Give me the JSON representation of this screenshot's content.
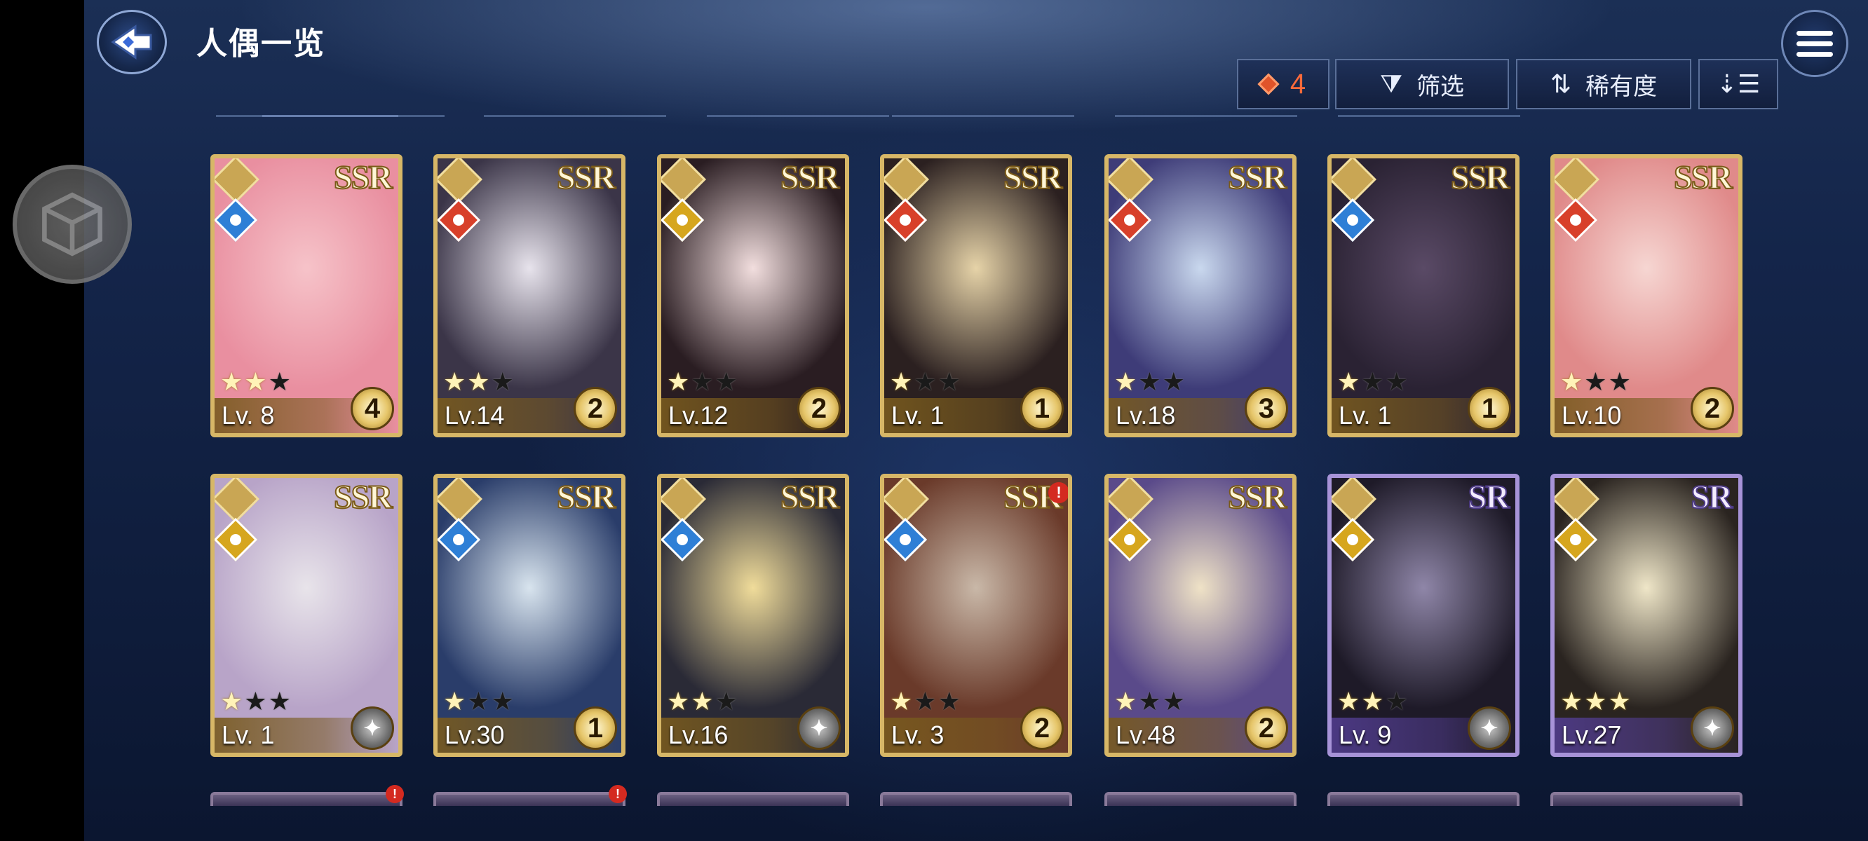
{
  "header": {
    "title": "人偶一览"
  },
  "toolbar": {
    "count": "4",
    "filter_label": "筛选",
    "rarity_label": "稀有度"
  },
  "colors": {
    "ssr_frame": "#d7b767",
    "sr_frame": "#a793d8",
    "count_accent": "#ff6a3a"
  },
  "cards": [
    {
      "rarity": "SSR",
      "element": "water",
      "stars": 2,
      "max_stars": 3,
      "level": "Lv. 8",
      "badge": "4",
      "art": [
        "#f6c3c9",
        "#e98fa0"
      ]
    },
    {
      "rarity": "SSR",
      "element": "fire",
      "stars": 2,
      "max_stars": 3,
      "level": "Lv.14",
      "badge": "2",
      "art": [
        "#e7e3ec",
        "#3b3548"
      ]
    },
    {
      "rarity": "SSR",
      "element": "light",
      "stars": 1,
      "max_stars": 3,
      "level": "Lv.12",
      "badge": "2",
      "art": [
        "#f2dede",
        "#2a1d22"
      ]
    },
    {
      "rarity": "SSR",
      "element": "fire",
      "stars": 1,
      "max_stars": 3,
      "level": "Lv. 1",
      "badge": "1",
      "art": [
        "#e6d3a8",
        "#2b2020"
      ]
    },
    {
      "rarity": "SSR",
      "element": "fire",
      "stars": 1,
      "max_stars": 3,
      "level": "Lv.18",
      "badge": "3",
      "art": [
        "#c9d8ee",
        "#3e3c78"
      ]
    },
    {
      "rarity": "SSR",
      "element": "water",
      "stars": 1,
      "max_stars": 3,
      "level": "Lv. 1",
      "badge": "1",
      "art": [
        "#5a4a66",
        "#2a2233"
      ]
    },
    {
      "rarity": "SSR",
      "element": "fire",
      "stars": 1,
      "max_stars": 3,
      "level": "Lv.10",
      "badge": "2",
      "art": [
        "#f6d6d2",
        "#e08a8a"
      ]
    },
    {
      "rarity": "SSR",
      "element": "light",
      "stars": 1,
      "max_stars": 3,
      "level": "Lv. 1",
      "badge": "",
      "art": [
        "#e8e4ea",
        "#b8a4c8"
      ]
    },
    {
      "rarity": "SSR",
      "element": "water",
      "stars": 1,
      "max_stars": 3,
      "level": "Lv.30",
      "badge": "1",
      "art": [
        "#d8e4ee",
        "#2a3d6a"
      ]
    },
    {
      "rarity": "SSR",
      "element": "water",
      "stars": 2,
      "max_stars": 3,
      "level": "Lv.16",
      "badge": "",
      "art": [
        "#f0dc9a",
        "#2a2a36"
      ]
    },
    {
      "rarity": "SSR",
      "element": "water",
      "stars": 1,
      "max_stars": 3,
      "level": "Lv. 3",
      "badge": "2",
      "art": [
        "#c9b8a8",
        "#6a3a2a"
      ],
      "alert": "!"
    },
    {
      "rarity": "SSR",
      "element": "light",
      "stars": 1,
      "max_stars": 3,
      "level": "Lv.48",
      "badge": "2",
      "art": [
        "#efe2c6",
        "#5a4a8a"
      ]
    },
    {
      "rarity": "SR",
      "element": "light",
      "stars": 2,
      "max_stars": 3,
      "level": "Lv. 9",
      "badge": "",
      "art": [
        "#8f86a8",
        "#1e1a28"
      ]
    },
    {
      "rarity": "SR",
      "element": "light",
      "stars": 3,
      "max_stars": 3,
      "level": "Lv.27",
      "badge": "",
      "art": [
        "#efe6c8",
        "#2a2420"
      ]
    }
  ],
  "peek_alerts": [
    "!",
    "!"
  ]
}
